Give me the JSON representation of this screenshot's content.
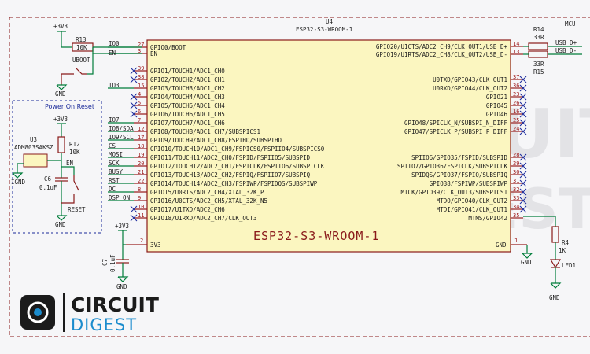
{
  "sheet": {
    "title": "MCU"
  },
  "module": {
    "ref": "U4",
    "value": "ESP32-S3-WROOM-1",
    "body_label": "ESP32-S3-WROOM-1",
    "left_pins": [
      {
        "name": "GPIO0/BOOT",
        "num": "27",
        "net": "IO0"
      },
      {
        "name": "EN",
        "num": "3",
        "net": "EN"
      },
      {
        "name": "GPIO1/TOUCH1/ADC1_CH0",
        "num": "39",
        "net": ""
      },
      {
        "name": "GPIO2/TOUCH2/ADC1_CH1",
        "num": "38",
        "net": ""
      },
      {
        "name": "GPIO3/TOUCH3/ADC1_CH2",
        "num": "15",
        "net": "IO3"
      },
      {
        "name": "GPIO4/TOUCH4/ADC1_CH3",
        "num": "4",
        "net": ""
      },
      {
        "name": "GPIO5/TOUCH5/ADC1_CH4",
        "num": "5",
        "net": ""
      },
      {
        "name": "GPIO6/TOUCH6/ADC1_CH5",
        "num": "6",
        "net": ""
      },
      {
        "name": "GPIO7/TOUCH7/ADC1_CH6",
        "num": "7",
        "net": "IO7"
      },
      {
        "name": "GPIO8/TOUCH8/ADC1_CH7/SUBSPICS1",
        "num": "12",
        "net": "IO8/SDA"
      },
      {
        "name": "GPIO9/TOUCH9/ADC1_CH8/FSPIHD/SUBSPIHD",
        "num": "17",
        "net": "IO9/SCL"
      },
      {
        "name": "GPIO10/TOUCH10/ADC1_CH9/FSPICS0/FSPIIO4/SUBSPICS0",
        "num": "18",
        "net": "CS"
      },
      {
        "name": "GPIO11/TOUCH11/ADC2_CH0/FSPID/FSPIIO5/SUBSPID",
        "num": "19",
        "net": "MOSI"
      },
      {
        "name": "GPIO12/TOUCH12/ADC2_CH1/FSPICLK/FSPIIO6/SUBSPICLK",
        "num": "20",
        "net": "SCK"
      },
      {
        "name": "GPIO13/TOUCH13/ADC2_CH2/FSPIQ/FSPIIO7/SUBSPIQ",
        "num": "21",
        "net": "BUSY"
      },
      {
        "name": "GPIO14/TOUCH14/ADC2_CH3/FSPIWP/FSPIDQS/SUBSPIWP",
        "num": "22",
        "net": "RST"
      },
      {
        "name": "GPIO15/U0RTS/ADC2_CH4/XTAL_32K_P",
        "num": "8",
        "net": "DC"
      },
      {
        "name": "GPIO16/U0CTS/ADC2_CH5/XTAL_32K_N5",
        "num": "9",
        "net": "DSP_ON"
      },
      {
        "name": "GPIO17/U1TXD/ADC2_CH6",
        "num": "10",
        "net": ""
      },
      {
        "name": "GPIO18/U1RXD/ADC2_CH7/CLK_OUT3",
        "num": "11",
        "net": ""
      }
    ],
    "right_pins": [
      {
        "name": "GPIO20/U1CTS/ADC2_CH9/CLK_OUT1/USB_D+",
        "num": "14"
      },
      {
        "name": "GPIO19/U1RTS/ADC2_CH8/CLK_OUT2/USB_D-",
        "num": "13"
      },
      {
        "name": "U0TXD/GPIO43/CLK_OUT1",
        "num": "37"
      },
      {
        "name": "U0RXD/GPIO44/CLK_OUT2",
        "num": "36"
      },
      {
        "name": "GPIO21",
        "num": "23"
      },
      {
        "name": "GPIO45",
        "num": "26"
      },
      {
        "name": "GPIO46",
        "num": "16"
      },
      {
        "name": "GPIO48/SPICLK_N/SUBSPI_N_DIFF",
        "num": "25"
      },
      {
        "name": "GPIO47/SPICLK_P/SUBSPI_P_DIFF",
        "num": "24"
      },
      {
        "name": "SPIIO6/GPIO35/FSPID/SUBSPID",
        "num": "28"
      },
      {
        "name": "SPIIO7/GPIO36/FSPICLK/SUBSPICLK",
        "num": "29"
      },
      {
        "name": "SPIDQS/GPIO37/FSPIQ/SUBSPIQ",
        "num": "30"
      },
      {
        "name": "GPIO38/FSPIWP/SUBSPIWP",
        "num": "31"
      },
      {
        "name": "MTCK/GPIO39/CLK_OUT3/SUBSPICS1",
        "num": "32"
      },
      {
        "name": "MTDO/GPIO40/CLK_OUT2",
        "num": "33"
      },
      {
        "name": "MTDI/GPIO41/CLK_OUT1",
        "num": "34"
      },
      {
        "name": "MTMS/GPIO42",
        "num": "35"
      }
    ],
    "power_pins": [
      {
        "name": "3V3",
        "num": "2"
      },
      {
        "name": "GND",
        "num": "1"
      }
    ]
  },
  "components": {
    "r13": {
      "ref": "R13",
      "value": "10K"
    },
    "boot_sw": {
      "label": "UBOOT"
    },
    "r14": {
      "ref": "R14",
      "value": "33R"
    },
    "r15": {
      "ref": "R15",
      "value": "33R"
    },
    "r12": {
      "ref": "R12",
      "value": "10K"
    },
    "u3": {
      "ref": "U3",
      "value": "ADM803SAKSZ"
    },
    "c6": {
      "ref": "C6",
      "value": "0.1uF"
    },
    "reset_sw": {
      "label": "RESET"
    },
    "c7": {
      "ref": "C7",
      "value": "0.1uF"
    },
    "r4": {
      "ref": "R4",
      "value": "1K"
    },
    "led1": {
      "ref": "LED1"
    }
  },
  "power": {
    "vcc": "+3V3",
    "gnd": "GND",
    "ignd": "IGND",
    "en": "EN"
  },
  "usb": {
    "dp": "USB_D+",
    "dm": "USB_D-"
  },
  "power_on_reset": {
    "title": "Power On Reset"
  },
  "logo": {
    "line1": "CIRCUIT",
    "line2": "DIGEST"
  },
  "watermark": {
    "line1": "CIRCUIT",
    "line2": "DIGEST"
  }
}
